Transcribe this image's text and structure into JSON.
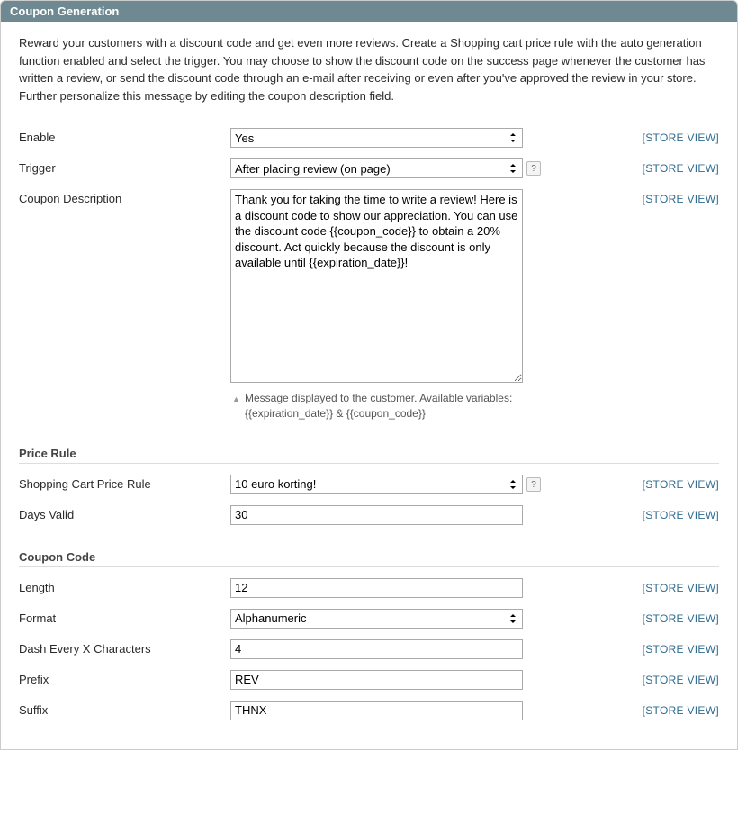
{
  "header": {
    "title": "Coupon Generation"
  },
  "intro": "Reward your customers with a discount code and get even more reviews. Create a Shopping cart price rule with the auto generation function enabled and select the trigger. You may choose to show the discount code on the success page whenever the customer has written a review, or send the discount code through an e-mail after receiving or even after you've approved the review in your store. Further personalize this message by editing the coupon description field.",
  "scope_label": "[STORE VIEW]",
  "fields": {
    "enable": {
      "label": "Enable",
      "value": "Yes"
    },
    "trigger": {
      "label": "Trigger",
      "value": "After placing review (on page)"
    },
    "coupon_description": {
      "label": "Coupon Description",
      "value": "Thank you for taking the time to write a review! Here is a discount code to show our appreciation. You can use the discount code {{coupon_code}} to obtain a 20% discount. Act quickly because the discount is only available until {{expiration_date}}!",
      "hint": "Message displayed to the customer. Available variables: {{expiration_date}} & {{coupon_code}}"
    }
  },
  "sections": {
    "price_rule": {
      "heading": "Price Rule",
      "shopping_cart_price_rule": {
        "label": "Shopping Cart Price Rule",
        "value": "10 euro korting!"
      },
      "days_valid": {
        "label": "Days Valid",
        "value": "30"
      }
    },
    "coupon_code": {
      "heading": "Coupon Code",
      "length": {
        "label": "Length",
        "value": "12"
      },
      "format": {
        "label": "Format",
        "value": "Alphanumeric"
      },
      "dash": {
        "label": "Dash Every X Characters",
        "value": "4"
      },
      "prefix": {
        "label": "Prefix",
        "value": "REV"
      },
      "suffix": {
        "label": "Suffix",
        "value": "THNX"
      }
    }
  }
}
